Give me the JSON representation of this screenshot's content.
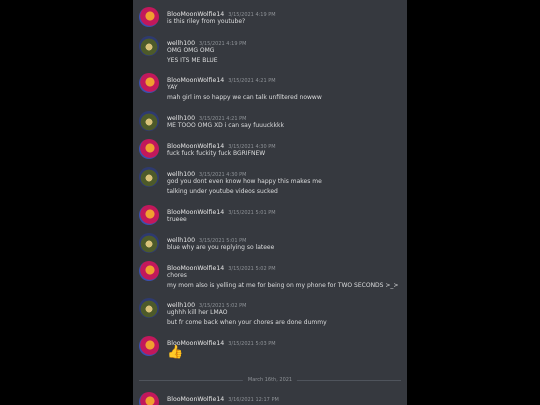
{
  "messages": [
    {
      "user": "BlooMoonWolfie14",
      "timestamp": "3/15/2021 4:19 PM",
      "avatar": "pink",
      "lines": [
        "is this riley from youtube?"
      ]
    },
    {
      "user": "wellh100",
      "timestamp": "3/15/2021 4:19 PM",
      "avatar": "owl",
      "lines": [
        "OMG OMG OMG",
        "YES ITS ME BLUE"
      ]
    },
    {
      "user": "BlooMoonWolfie14",
      "timestamp": "3/15/2021 4:21 PM",
      "avatar": "pink",
      "lines": [
        "YAY",
        "mah girl im so happy we can talk unfiltered nowww"
      ]
    },
    {
      "user": "wellh100",
      "timestamp": "3/15/2021 4:21 PM",
      "avatar": "owl",
      "lines": [
        "ME TOOO OMG XD i can say fuuuckkkk"
      ]
    },
    {
      "user": "BlooMoonWolfie14",
      "timestamp": "3/15/2021 4:30 PM",
      "avatar": "pink",
      "lines": [
        "fuck fuck fuckity fuck BGRIFNEW"
      ]
    },
    {
      "user": "wellh100",
      "timestamp": "3/15/2021 4:30 PM",
      "avatar": "owl",
      "lines": [
        "god you dont even know how happy this makes me",
        "talking under youtube videos sucked"
      ]
    },
    {
      "user": "BlooMoonWolfie14",
      "timestamp": "3/15/2021 5:01 PM",
      "avatar": "pink",
      "lines": [
        "trueee"
      ]
    },
    {
      "user": "wellh100",
      "timestamp": "3/15/2021 5:01 PM",
      "avatar": "owl",
      "lines": [
        "blue why are you replying so lateee"
      ]
    },
    {
      "user": "BlooMoonWolfie14",
      "timestamp": "3/15/2021 5:02 PM",
      "avatar": "pink",
      "lines": [
        "chores",
        "my mom also is yelling at me for being on my phone for TWO SECONDS >_>"
      ]
    },
    {
      "user": "wellh100",
      "timestamp": "3/15/2021 5:02 PM",
      "avatar": "owl",
      "lines": [
        "ughhh kill her LMAO",
        "but fr come back when your chores are done dummy"
      ]
    },
    {
      "user": "BlooMoonWolfie14",
      "timestamp": "3/15/2021 5:03 PM",
      "avatar": "pink",
      "lines": [],
      "emoji": "👍"
    },
    {
      "user": "BlooMoonWolfie14",
      "timestamp": "3/16/2021 12:17 PM",
      "avatar": "pink",
      "lines": []
    }
  ],
  "date_divider": "March 16th, 2021"
}
